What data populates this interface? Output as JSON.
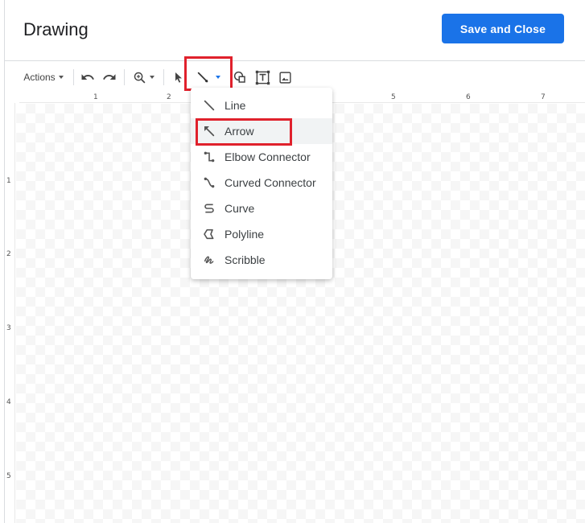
{
  "dialog": {
    "title": "Drawing",
    "save_button_label": "Save and Close"
  },
  "toolbar": {
    "actions_label": "Actions",
    "items": [
      "undo-icon",
      "redo-icon",
      "zoom-icon",
      "select-icon",
      "line-icon",
      "shape-icon",
      "text-box-icon",
      "image-icon"
    ]
  },
  "ruler": {
    "horizontal": [
      "1",
      "2",
      "5",
      "6",
      "7"
    ],
    "vertical": [
      "1",
      "2",
      "3",
      "4",
      "5"
    ]
  },
  "line_menu": {
    "items": [
      {
        "label": "Line",
        "icon": "line-icon"
      },
      {
        "label": "Arrow",
        "icon": "arrow-icon"
      },
      {
        "label": "Elbow Connector",
        "icon": "elbow-connector-icon"
      },
      {
        "label": "Curved Connector",
        "icon": "curved-connector-icon"
      },
      {
        "label": "Curve",
        "icon": "curve-icon"
      },
      {
        "label": "Polyline",
        "icon": "polyline-icon"
      },
      {
        "label": "Scribble",
        "icon": "scribble-icon"
      }
    ],
    "highlighted_item": "Arrow"
  },
  "colors": {
    "accent": "#1a73e8",
    "highlight_box": "#e0212c"
  }
}
